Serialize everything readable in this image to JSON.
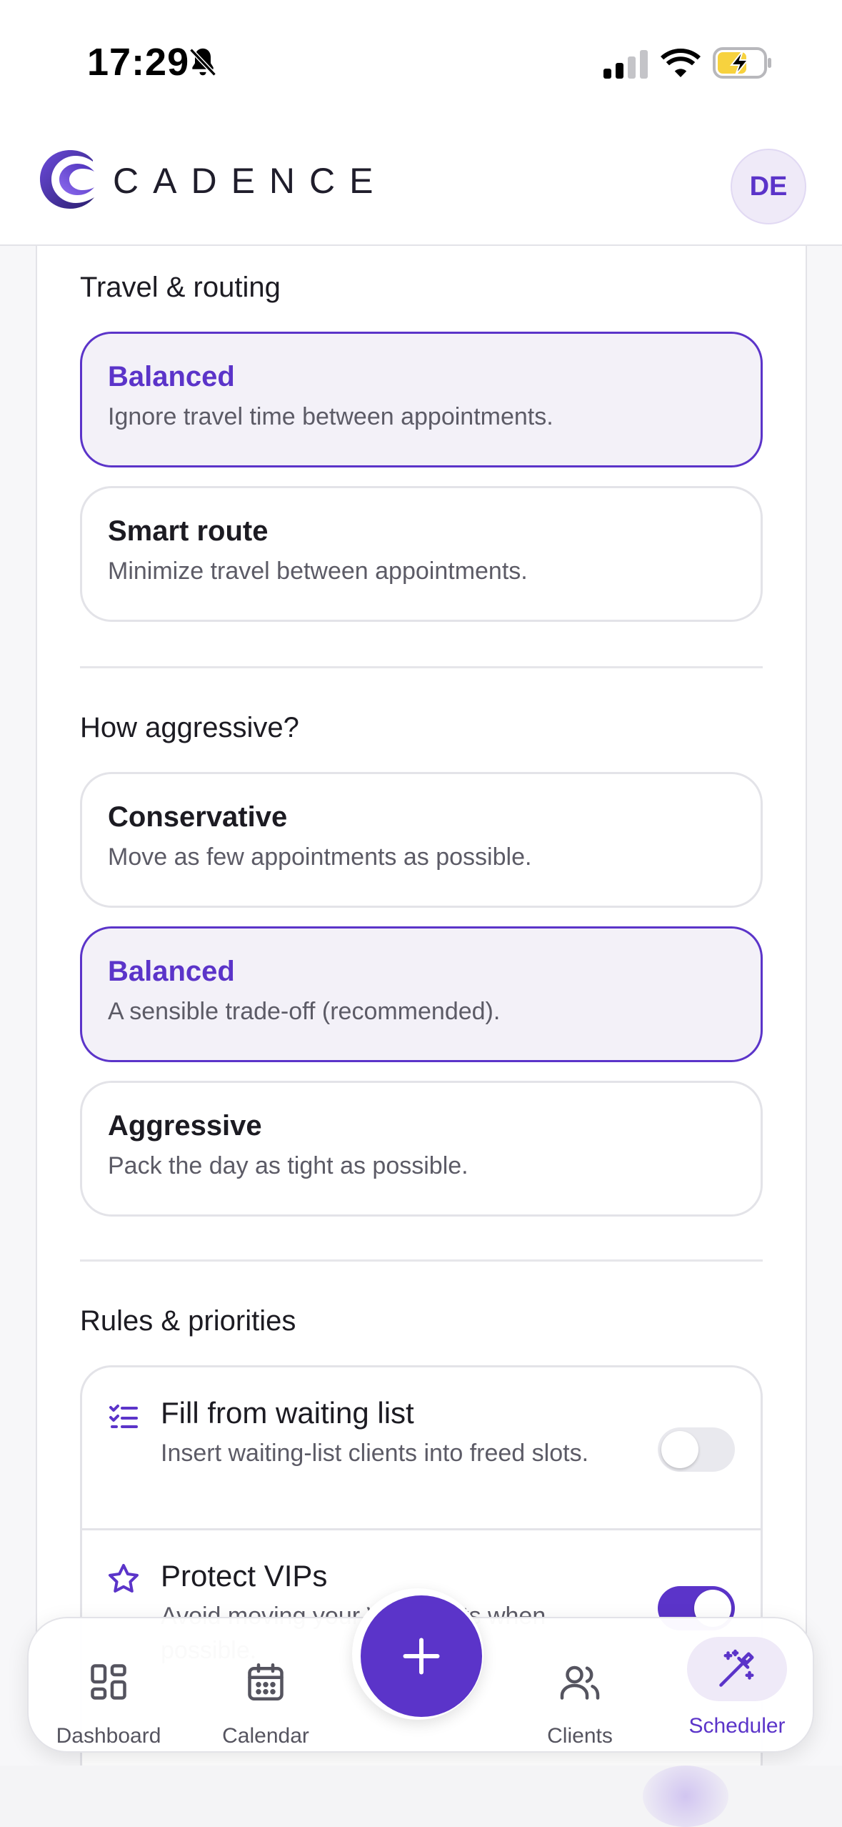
{
  "status_bar": {
    "time": "17:29"
  },
  "header": {
    "logo_text": "CADENCE",
    "avatar_initials": "DE"
  },
  "travel": {
    "title": "Travel & routing",
    "options": [
      {
        "title": "Balanced",
        "description": "Ignore travel time between appointments.",
        "selected": true
      },
      {
        "title": "Smart route",
        "description": "Minimize travel between appointments.",
        "selected": false
      }
    ]
  },
  "aggressiveness": {
    "title": "How aggressive?",
    "options": [
      {
        "title": "Conservative",
        "description": "Move as few appointments as possible.",
        "selected": false
      },
      {
        "title": "Balanced",
        "description": "A sensible trade-off (recommended).",
        "selected": true
      },
      {
        "title": "Aggressive",
        "description": "Pack the day as tight as possible.",
        "selected": false
      }
    ]
  },
  "rules": {
    "title": "Rules & priorities",
    "items": [
      {
        "title": "Fill from waiting list",
        "description": "Insert waiting-list clients into freed slots.",
        "enabled": false,
        "icon": "list-check-icon"
      },
      {
        "title": "Protect VIPs",
        "description": "Avoid moving your VIP clients when possible.",
        "enabled": true,
        "icon": "star-icon"
      }
    ]
  },
  "nav": {
    "items": [
      {
        "label": "Dashboard",
        "icon": "dashboard-icon",
        "active": false
      },
      {
        "label": "Calendar",
        "icon": "calendar-icon",
        "active": false
      },
      {
        "label": "Clients",
        "icon": "users-icon",
        "active": false
      },
      {
        "label": "Scheduler",
        "icon": "magic-wand-icon",
        "active": true
      }
    ],
    "fab_icon": "plus-icon"
  },
  "colors": {
    "accent": "#5b34c9",
    "accent_bg": "#f3f1f8",
    "border": "#e3e3e8"
  }
}
